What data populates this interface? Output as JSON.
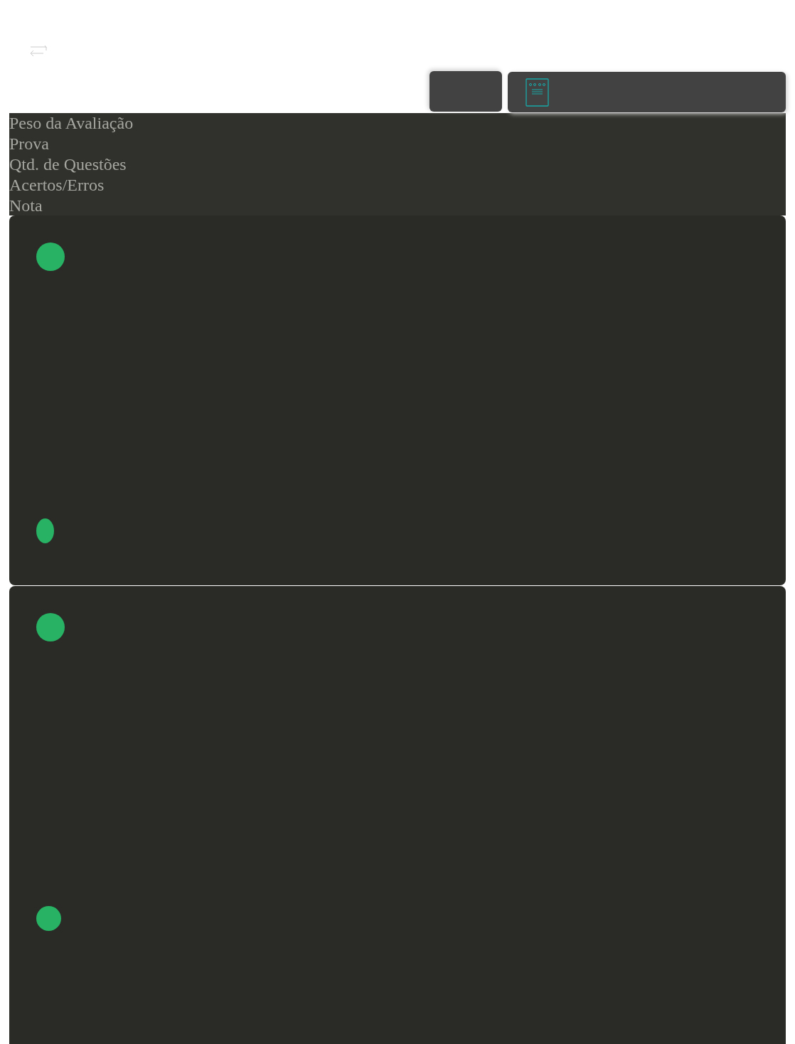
{
  "header_labels": [
    "Peso da Avaliação",
    "Prova",
    "Qtd. de Questões",
    "Acertos/Erros",
    "Nota"
  ],
  "cards": [
    {
      "markers": [
        {
          "kind": "circle"
        },
        {
          "kind": "oval"
        }
      ]
    },
    {
      "markers": [
        {
          "kind": "circle"
        },
        {
          "kind": "small-circle"
        }
      ]
    }
  ]
}
